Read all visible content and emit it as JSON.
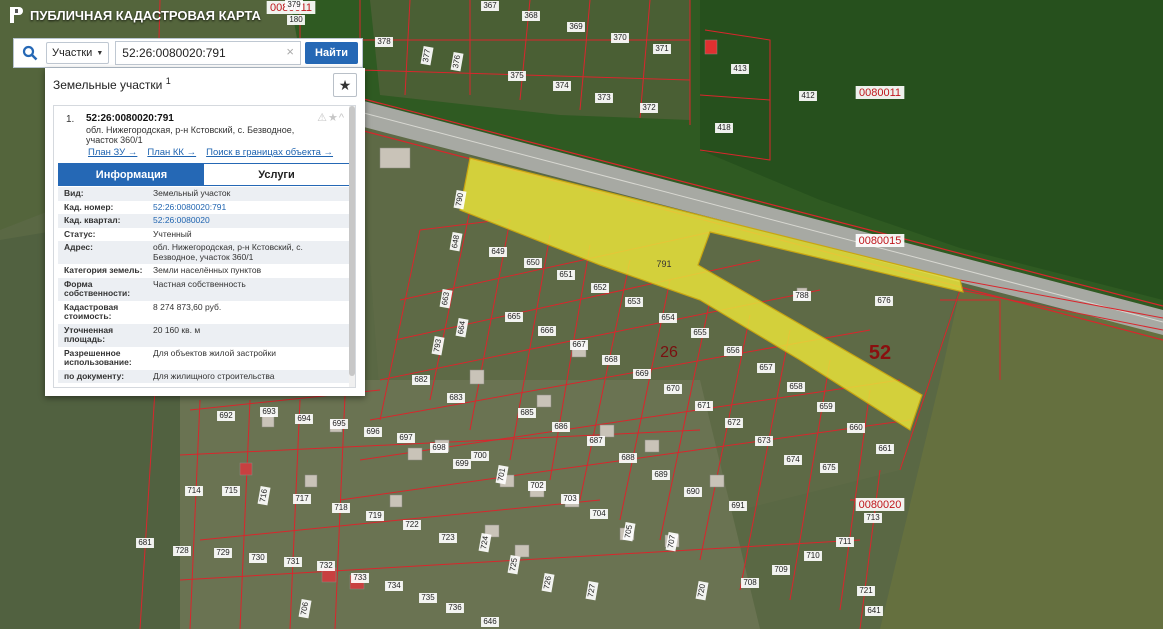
{
  "app": {
    "title": "ПУБЛИЧНАЯ КАДАСТРОВАЯ КАРТА"
  },
  "search": {
    "type_selected": "Участки",
    "query": "52:26:0080020:791",
    "button": "Найти"
  },
  "panel": {
    "title": "Земельные участки",
    "count": "1",
    "result": {
      "index": "1.",
      "number": "52:26:0080020:791",
      "address": "обл. Нижегородская, р-н Кстовский, с. Безводное, участок 360/1",
      "links": [
        "План ЗУ →",
        "План КК →",
        "Поиск в границах объекта →"
      ]
    },
    "tabs": [
      "Информация",
      "Услуги"
    ],
    "properties": [
      {
        "key": "Вид:",
        "value": "Земельный участок",
        "link": false
      },
      {
        "key": "Кад. номер:",
        "value": "52:26:0080020:791",
        "link": true
      },
      {
        "key": "Кад. квартал:",
        "value": "52:26:0080020",
        "link": true
      },
      {
        "key": "Статус:",
        "value": "Учтенный",
        "link": false
      },
      {
        "key": "Адрес:",
        "value": "обл. Нижегородская, р-н Кстовский, с. Безводное, участок 360/1",
        "link": false
      },
      {
        "key": "Категория земель:",
        "value": "Земли населённых пунктов",
        "link": false
      },
      {
        "key": "Форма собственности:",
        "value": "Частная собственность",
        "link": false
      },
      {
        "key": "Кадастровая стоимость:",
        "value": "8 274 873,60 руб.",
        "link": false
      },
      {
        "key": "Уточненная площадь:",
        "value": "20 160 кв. м",
        "link": false
      },
      {
        "key": "Разрешенное использование:",
        "value": "Для объектов жилой застройки",
        "link": false
      },
      {
        "key": "по документу:",
        "value": "Для жилищного строительства",
        "link": false
      }
    ]
  },
  "map": {
    "colors": {
      "boundary": "#d9262c",
      "label_bg": "#ffffff",
      "highlight": "#e8e23a",
      "forest": "#2f5a22",
      "field": "#5f6c45",
      "road": "#a7a9a3"
    },
    "quarter_labels": [
      "0080011",
      "0080011",
      "0080015",
      "0080020"
    ],
    "district_labels": [
      "26",
      "52"
    ],
    "selected_label": "791",
    "parcel_labels": [
      "367",
      "368",
      "369",
      "370",
      "371",
      "376",
      "377",
      "378",
      "375",
      "374",
      "373",
      "372",
      "379",
      "180",
      "413",
      "412",
      "418",
      "648",
      "649",
      "650",
      "651",
      "652",
      "653",
      "654",
      "655",
      "656",
      "657",
      "658",
      "659",
      "660",
      "661",
      "663",
      "664",
      "665",
      "666",
      "667",
      "668",
      "669",
      "670",
      "671",
      "672",
      "673",
      "674",
      "675",
      "676",
      "788",
      "790",
      "793",
      "682",
      "683",
      "685",
      "686",
      "687",
      "688",
      "689",
      "690",
      "691",
      "692",
      "693",
      "694",
      "695",
      "696",
      "697",
      "698",
      "699",
      "700",
      "701",
      "702",
      "703",
      "704",
      "705",
      "707",
      "708",
      "709",
      "710",
      "711",
      "713",
      "714",
      "715",
      "716",
      "717",
      "718",
      "719",
      "722",
      "723",
      "724",
      "725",
      "726",
      "727",
      "728",
      "729",
      "730",
      "731",
      "732",
      "733",
      "734",
      "735",
      "736",
      "646",
      "706",
      "720",
      "721",
      "681",
      "641"
    ]
  }
}
